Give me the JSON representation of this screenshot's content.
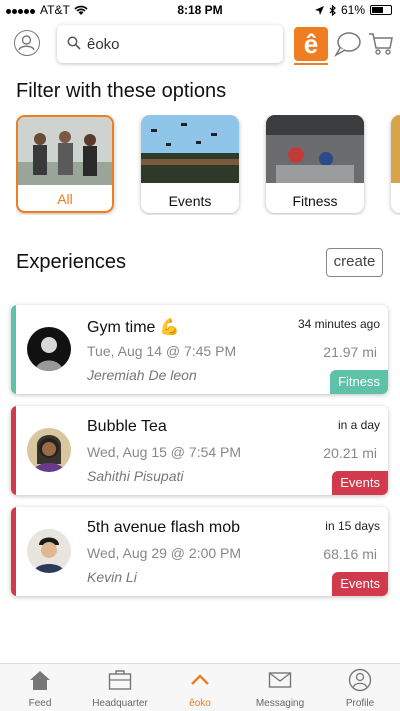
{
  "status_bar": {
    "carrier": "AT&T",
    "time": "8:18 PM",
    "battery": "61%",
    "battery_level": 0.61
  },
  "search": {
    "value": "êoko",
    "placeholder": "êoko"
  },
  "logo": {
    "glyph": "ê"
  },
  "filter": {
    "title": "Filter with these options",
    "options": [
      {
        "label": "All",
        "selected": true
      },
      {
        "label": "Events",
        "selected": false
      },
      {
        "label": "Fitness",
        "selected": false
      }
    ]
  },
  "experiences": {
    "title": "Experiences",
    "create_label": "create",
    "items": [
      {
        "title": "Gym time 💪",
        "date": "Tue, Aug 14 @ 7:45 PM",
        "host": "Jeremiah De leon",
        "when": "34 minutes ago",
        "distance": "21.97 mi",
        "tag": "Fitness",
        "tag_color": "#5ec2a8"
      },
      {
        "title": "Bubble Tea",
        "date": "Wed, Aug 15 @ 7:54 PM",
        "host": "Sahithi Pisupati",
        "when": "in a day",
        "distance": "20.21 mi",
        "tag": "Events",
        "tag_color": "#d03a4c"
      },
      {
        "title": "5th avenue flash mob",
        "date": "Wed, Aug 29 @ 2:00 PM",
        "host": "Kevin Li",
        "when": "in 15 days",
        "distance": "68.16 mi",
        "tag": "Events",
        "tag_color": "#d03a4c"
      }
    ]
  },
  "tabs": [
    {
      "label": "Feed",
      "icon": "house-icon"
    },
    {
      "label": "Headquarter",
      "icon": "briefcase-icon"
    },
    {
      "label": "êoko",
      "icon": "chevron-up-icon",
      "active": true
    },
    {
      "label": "Messaging",
      "icon": "envelope-icon"
    },
    {
      "label": "Profile",
      "icon": "person-icon"
    }
  ],
  "colors": {
    "accent": "#ef7d22",
    "fitness": "#5ec2a8",
    "events": "#d03a4c"
  }
}
